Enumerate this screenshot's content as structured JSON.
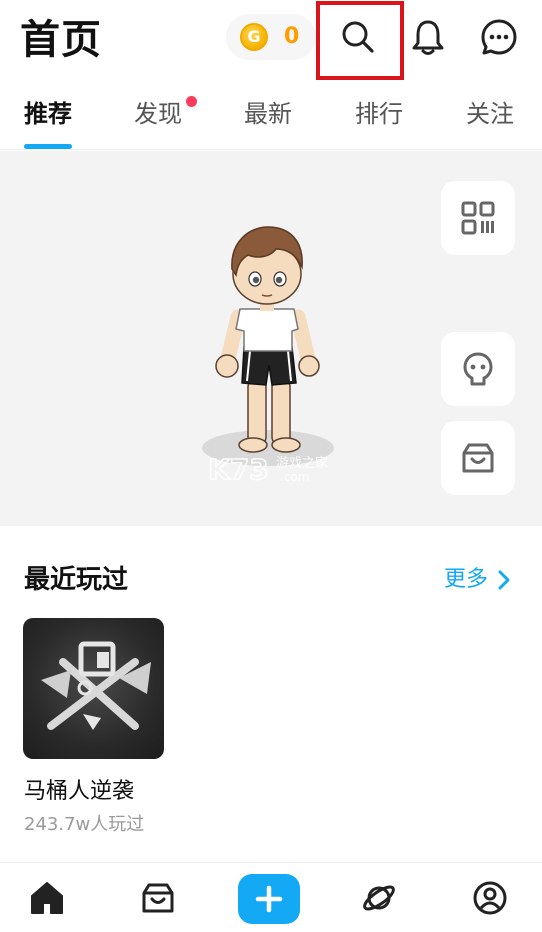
{
  "header": {
    "title": "首页",
    "coin_icon_letter": "G",
    "coin_count": "0",
    "icons": [
      "search-icon",
      "bell-icon",
      "message-icon"
    ]
  },
  "tabs": [
    {
      "label": "推荐",
      "active": true
    },
    {
      "label": "发现",
      "active": false,
      "badge": true
    },
    {
      "label": "最新",
      "active": false
    },
    {
      "label": "排行",
      "active": false
    },
    {
      "label": "关注",
      "active": false
    }
  ],
  "stage": {
    "side_buttons": [
      "qr-code-icon",
      "ghost-icon",
      "shopping-bag-icon"
    ],
    "watermark": {
      "brand": "K73",
      "text": "游戏之家",
      "domain": ".com"
    }
  },
  "recent": {
    "title": "最近玩过",
    "more_label": "更多",
    "games": [
      {
        "name": "马桶人逆袭",
        "players": "243.7w人玩过"
      }
    ]
  },
  "bottom_nav": [
    "home-icon",
    "store-icon",
    "add-icon",
    "explore-planet-icon",
    "profile-icon"
  ],
  "colors": {
    "accent": "#14a9f4",
    "coin": "#ff9d00",
    "badge": "#ff3b5c",
    "highlight_box": "#d9141a",
    "stage_bg": "#f3f3f3"
  }
}
